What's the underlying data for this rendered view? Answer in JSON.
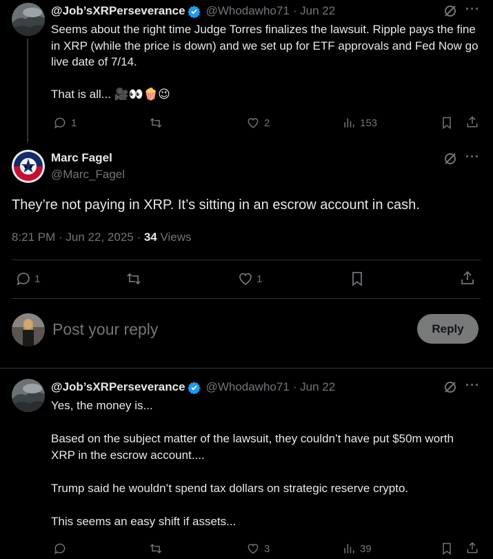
{
  "tweet1": {
    "display_name": "@Job’sXRPerseverance",
    "handle": "@Whodawho71",
    "date": "· Jun 22",
    "text": "Seems about the right time Judge Torres finalizes the lawsuit. Ripple pays the fine in XRP (while the price is down) and we set up for ETF approvals and Fed Now go live date of 7/14.\n\nThat is all... 🎥👀🍿😉",
    "replies": "1",
    "retweets": "",
    "likes": "2",
    "views": "153"
  },
  "main_tweet": {
    "display_name": "Marc Fagel",
    "handle": "@Marc_Fagel",
    "text": "They’re not paying in XRP. It’s sitting in an escrow account in cash.",
    "timestamp": "8:21 PM · Jun 22, 2025 · ",
    "views_count": "34",
    "views_label": " Views",
    "replies": "1",
    "retweets": "",
    "likes": "1"
  },
  "reply_box": {
    "placeholder": "Post your reply",
    "button_label": "Reply"
  },
  "tweet3": {
    "display_name": "@Job’sXRPerseverance",
    "handle": "@Whodawho71",
    "date": "· Jun 22",
    "text": "Yes, the money is...\n\nBased on the subject matter of the lawsuit, they couldn’t have put $50m worth XRP in the escrow account....\n\nTrump said he wouldn’t spend tax dollars on strategic reserve crypto.\n\nThis seems an easy shift if assets...",
    "replies": "",
    "retweets": "",
    "likes": "3",
    "views": "39"
  },
  "colors": {
    "background": "#000000",
    "text": "#e7e9ea",
    "muted": "#71767b",
    "verified": "#1d9bf0",
    "divider": "#2f3336",
    "reply_button": "#787a7a"
  },
  "icons": [
    "verified-icon",
    "grok-icon",
    "more-icon",
    "reply-icon",
    "retweet-icon",
    "like-icon",
    "views-icon",
    "bookmark-icon",
    "share-icon"
  ]
}
